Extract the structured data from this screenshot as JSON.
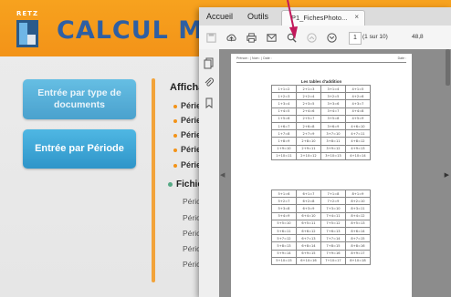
{
  "background_app": {
    "logo": {
      "brand": "RETZ"
    },
    "title": "CALCUL ME",
    "buttons": {
      "by_type": "Entrée par type de documents",
      "by_period": "Entrée par Période"
    },
    "affichage_label": "Affichag",
    "affichage_items": [
      "Périe",
      "Périe",
      "Périe",
      "Périe",
      "Périe"
    ],
    "fichier_label": "Fichier",
    "fichier_items": [
      "Périod",
      "Périod",
      "Périod",
      "Périod",
      "Périod"
    ]
  },
  "pdf_viewer": {
    "menu": {
      "home": "Accueil",
      "tools": "Outils"
    },
    "tab": {
      "title": "P1_FichesPhoto...",
      "close": "×"
    },
    "toolbar": {
      "page_current": "1",
      "page_total": "(1 sur 10)",
      "zoom": "48,8"
    },
    "document": {
      "header_left": "Prénom : | Nom : | Date :",
      "header_right": "Date :",
      "title": "Les tables d'addition",
      "table_a": [
        [
          "1+1=2",
          "2+1=3",
          "3+1=4",
          "4+1=5"
        ],
        [
          "1+2=3",
          "2+2=4",
          "3+2=5",
          "4+2=6"
        ],
        [
          "1+3=4",
          "2+3=5",
          "3+3=6",
          "4+3=7"
        ],
        [
          "1+4=5",
          "2+4=6",
          "3+4=7",
          "4+4=8"
        ],
        [
          "1+5=6",
          "2+5=7",
          "3+5=8",
          "4+5=9"
        ],
        [
          "1+6=7",
          "2+6=8",
          "3+6=9",
          "4+6=10"
        ],
        [
          "1+7=8",
          "2+7=9",
          "3+7=10",
          "4+7=11"
        ],
        [
          "1+8=9",
          "2+8=10",
          "3+8=11",
          "4+8=12"
        ],
        [
          "1+9=10",
          "2+9=11",
          "3+9=12",
          "4+9=13"
        ],
        [
          "1+10=11",
          "2+10=12",
          "3+10=13",
          "4+10=14"
        ]
      ],
      "table_b": [
        [
          "5+1=6",
          "6+1=7",
          "7+1=8",
          "8+1=9"
        ],
        [
          "5+2=7",
          "6+2=8",
          "7+2=9",
          "8+2=10"
        ],
        [
          "5+3=8",
          "6+3=9",
          "7+3=10",
          "8+3=11"
        ],
        [
          "5+4=9",
          "6+4=10",
          "7+4=11",
          "8+4=12"
        ],
        [
          "5+5=10",
          "6+5=11",
          "7+5=12",
          "8+5=13"
        ],
        [
          "5+6=11",
          "6+6=12",
          "7+6=13",
          "8+6=14"
        ],
        [
          "5+7=12",
          "6+7=13",
          "7+7=14",
          "8+7=15"
        ],
        [
          "5+8=13",
          "6+8=14",
          "7+8=15",
          "8+8=16"
        ],
        [
          "5+9=14",
          "6+9=15",
          "7+9=16",
          "8+9=17"
        ],
        [
          "5+10=15",
          "6+10=16",
          "7+10=17",
          "8+10=18"
        ]
      ]
    }
  },
  "colors": {
    "header_orange": "#f39318",
    "title_blue": "#2e5fa3",
    "button_blue": "#2f95c9",
    "arrow_pink": "#c2185b"
  }
}
